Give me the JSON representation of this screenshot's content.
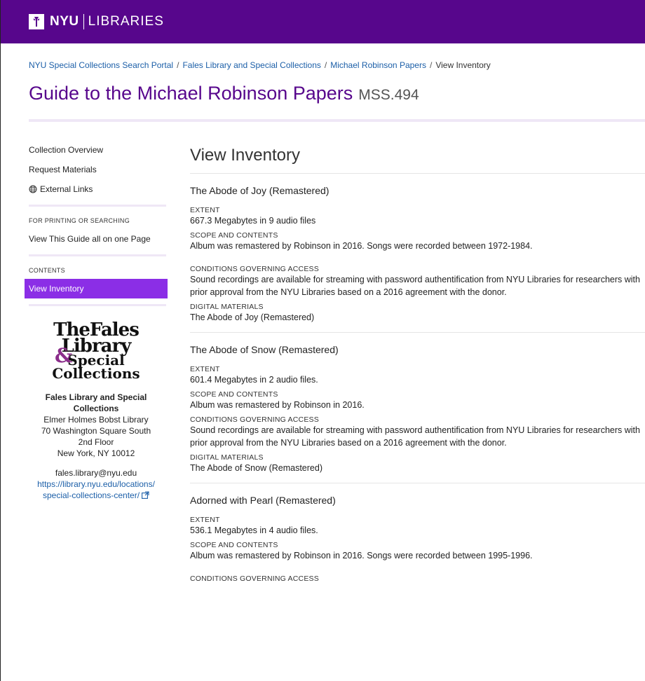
{
  "header": {
    "brand_nyu": "NYU",
    "brand_libraries": "LIBRARIES"
  },
  "breadcrumb": [
    "NYU Special Collections Search Portal",
    "Fales Library and Special Collections",
    "Michael Robinson Papers",
    "View Inventory"
  ],
  "page": {
    "title": "Guide to the Michael Robinson Papers",
    "call_number": "MSS.494"
  },
  "sidebar": {
    "links": [
      "Collection Overview",
      "Request Materials",
      "External Links"
    ],
    "printing_heading": "FOR PRINTING OR SEARCHING",
    "printing_link": "View This Guide all on one Page",
    "contents_heading": "CONTENTS",
    "contents_active": "View Inventory",
    "repository": {
      "name": "Fales Library and Special Collections",
      "line1": "Elmer Holmes Bobst Library",
      "line2": "70 Washington Square South",
      "line3": "2nd Floor",
      "line4": "New York, NY 10012",
      "email": "fales.library@nyu.edu",
      "url_line1": "https://library.nyu.edu/locations/",
      "url_line2": "special-collections-center/"
    }
  },
  "main": {
    "title": "View Inventory",
    "items": [
      {
        "title": "The Abode of Joy (Remastered)",
        "extent_label": "EXTENT",
        "extent": "667.3 Megabytes in 9 audio files",
        "scope_label": "SCOPE AND CONTENTS",
        "scope": "Album was remastered by Robinson in 2016. Songs were recorded between 1972-1984.",
        "access_label": "CONDITIONS GOVERNING ACCESS",
        "access": "Sound recordings are available for streaming with password authentification from NYU Libraries for researchers with prior approval from the NYU Libraries based on a 2016 agreement with the donor.",
        "digital_label": "DIGITAL MATERIALS",
        "digital": "The Abode of Joy (Remastered)"
      },
      {
        "title": "The Abode of Snow (Remastered)",
        "extent_label": "EXTENT",
        "extent": "601.4 Megabytes in 2 audio files.",
        "scope_label": "SCOPE AND CONTENTS",
        "scope": "Album was remastered by Robinson in 2016.",
        "access_label": "CONDITIONS GOVERNING ACCESS",
        "access": "Sound recordings are available for streaming with password authentification from NYU Libraries for researchers with prior approval from the NYU Libraries based on a 2016 agreement with the donor.",
        "digital_label": "DIGITAL MATERIALS",
        "digital": "The Abode of Snow (Remastered)"
      },
      {
        "title": "Adorned with Pearl (Remastered)",
        "extent_label": "EXTENT",
        "extent": "536.1 Megabytes in 4 audio files.",
        "scope_label": "SCOPE AND CONTENTS",
        "scope": "Album was remastered by Robinson in 2016. Songs were recorded between 1995-1996.",
        "access_label": "CONDITIONS GOVERNING ACCESS"
      }
    ]
  },
  "colors": {
    "brand_purple": "#57068c",
    "active_purple": "#8b2ee6",
    "link_blue": "#1c5fa8"
  }
}
